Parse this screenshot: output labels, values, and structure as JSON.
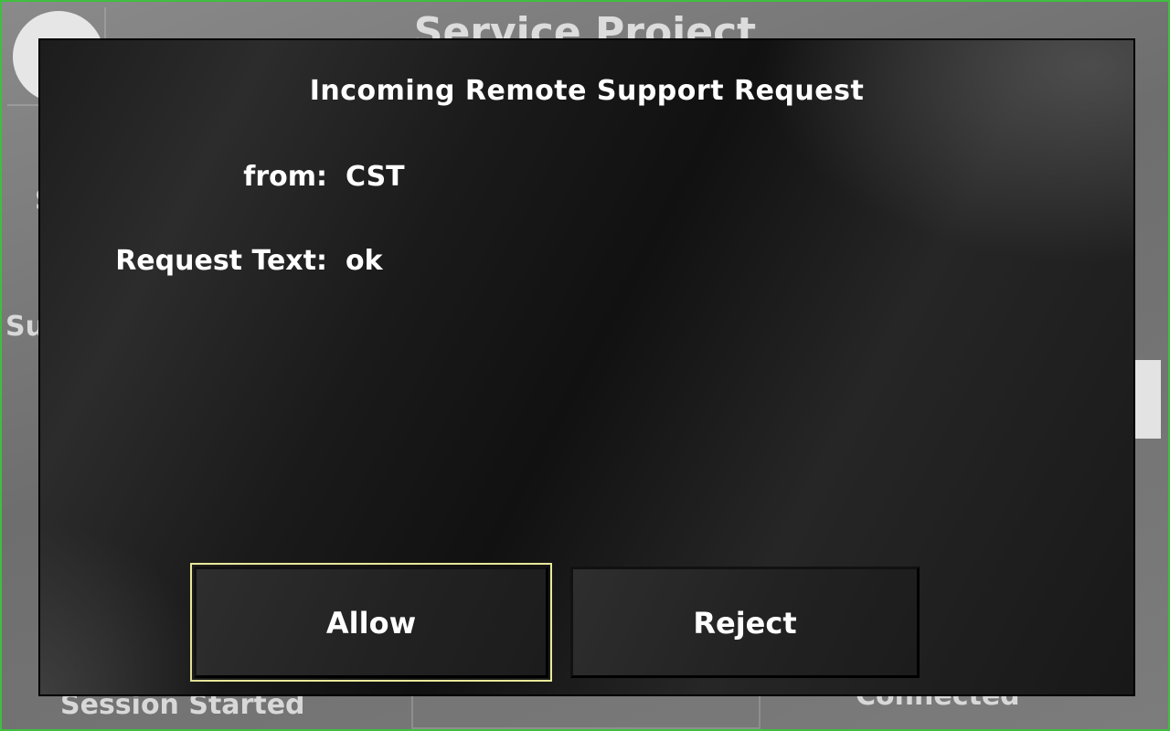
{
  "background": {
    "title": "Service Project",
    "side_label_1": "S",
    "side_label_2": "Su",
    "status_left": "Session Started",
    "status_right": "Connected",
    "status_icon": "checkmark-icon"
  },
  "dialog": {
    "title": "Incoming Remote Support Request",
    "from_label": "from:",
    "from_value": "CST",
    "request_label": "Request Text:",
    "request_value": "ok",
    "allow_label": "Allow",
    "reject_label": "Reject"
  },
  "colors": {
    "frame": "#3fbf3f",
    "focus_outline": "#e8e89a",
    "dialog_bg": "#1a1a1a",
    "text": "#ffffff"
  }
}
